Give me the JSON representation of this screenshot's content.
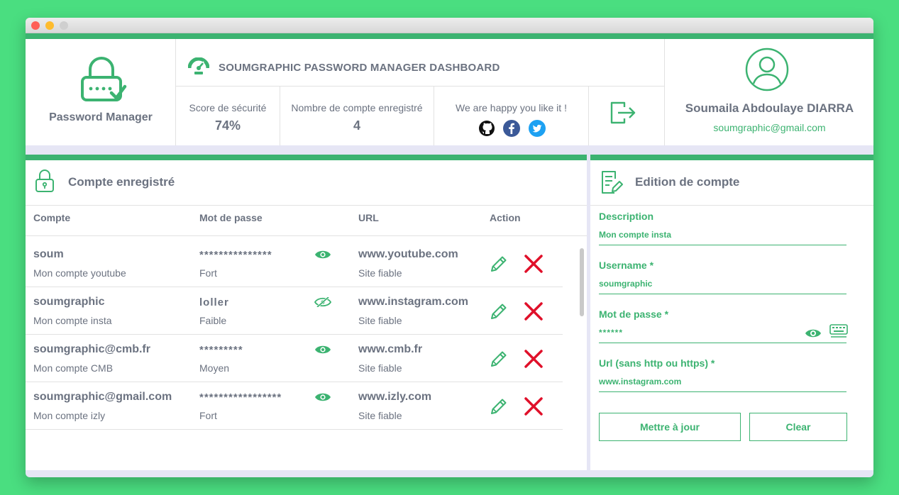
{
  "app": {
    "logo_title": "Password Manager",
    "dashboard_title": "SOUMGRAPHIC PASSWORD MANAGER DASHBOARD"
  },
  "stats": {
    "security_label": "Score de sécurité",
    "security_value": "74%",
    "count_label": "Nombre de compte enregistré",
    "count_value": "4",
    "happy_label": "We are happy you like it !"
  },
  "social": [
    "github-icon",
    "facebook-icon",
    "twitter-icon"
  ],
  "user": {
    "name": "Soumaila Abdoulaye DIARRA",
    "email": "soumgraphic@gmail.com"
  },
  "accounts": {
    "title": "Compte enregistré",
    "headers": {
      "compte": "Compte",
      "password": "Mot de passe",
      "url": "URL",
      "action": "Action"
    },
    "rows": [
      {
        "username": "soum",
        "description": "Mon compte youtube",
        "password": "***************",
        "strength": "Fort",
        "url": "www.youtube.com",
        "trust": "Site fiable",
        "visibility_icon": "eye-icon"
      },
      {
        "username": "soumgraphic",
        "description": "Mon compte insta",
        "password": "loller",
        "strength": "Faible",
        "url": "www.instagram.com",
        "trust": "Site fiable",
        "visibility_icon": "eye-slash-icon"
      },
      {
        "username": "soumgraphic@cmb.fr",
        "description": "Mon compte CMB",
        "password": "*********",
        "strength": "Moyen",
        "url": "www.cmb.fr",
        "trust": "Site fiable",
        "visibility_icon": "eye-icon"
      },
      {
        "username": "soumgraphic@gmail.com",
        "description": "Mon compte izly",
        "password": "*****************",
        "strength": "Fort",
        "url": "www.izly.com",
        "trust": "Site fiable",
        "visibility_icon": "eye-icon"
      }
    ]
  },
  "edit": {
    "title": "Edition de compte",
    "description_label": "Description",
    "description_value": "Mon compte insta",
    "username_label": "Username *",
    "username_value": "soumgraphic",
    "password_label": "Mot de passe *",
    "password_value": "******",
    "url_label": "Url (sans http ou https) *",
    "url_value": "www.instagram.com",
    "update_button": "Mettre à jour",
    "clear_button": "Clear"
  },
  "colors": {
    "accent": "#3cb371",
    "danger": "#e0102a",
    "background": "#4ade80",
    "text": "#6b7280"
  }
}
